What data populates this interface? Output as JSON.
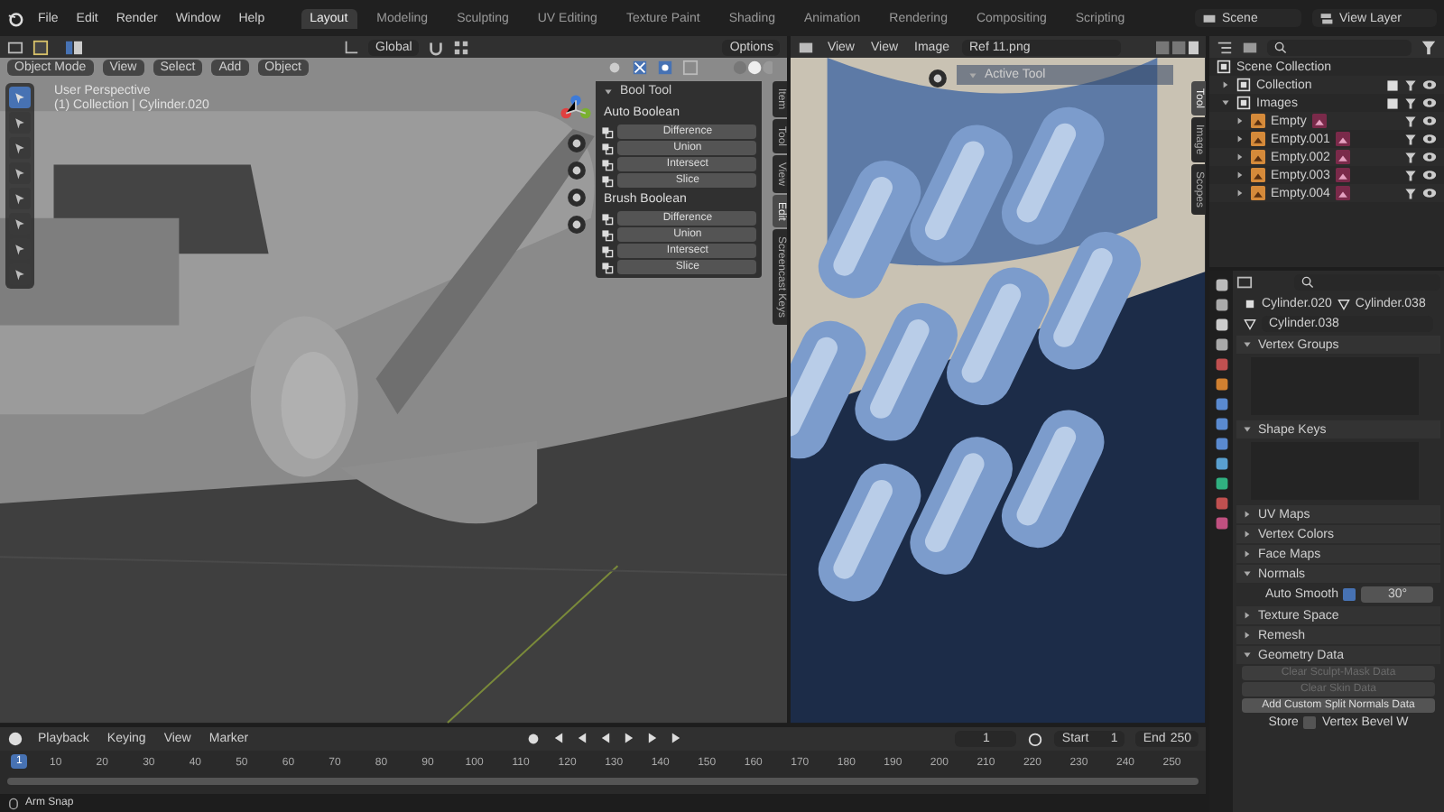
{
  "top_bar": {
    "menus": [
      "File",
      "Edit",
      "Render",
      "Window",
      "Help"
    ],
    "workspaces": [
      {
        "label": "Layout",
        "selected": true
      },
      {
        "label": "Modeling",
        "selected": false
      },
      {
        "label": "Sculpting",
        "selected": false
      },
      {
        "label": "UV Editing",
        "selected": false
      },
      {
        "label": "Texture Paint",
        "selected": false
      },
      {
        "label": "Shading",
        "selected": false
      },
      {
        "label": "Animation",
        "selected": false
      },
      {
        "label": "Rendering",
        "selected": false
      },
      {
        "label": "Compositing",
        "selected": false
      },
      {
        "label": "Scripting",
        "selected": false
      }
    ],
    "scene": "Scene",
    "view_layer": "View Layer"
  },
  "viewport": {
    "orientation": "Global",
    "options": "Options",
    "mode": "Object Mode",
    "menus": [
      "View",
      "Select",
      "Add",
      "Object"
    ],
    "overlay_text": [
      "User Perspective",
      "(1) Collection | Cylinder.020"
    ],
    "bool_tool": {
      "title": "Bool Tool",
      "sections": [
        {
          "heading": "Auto Boolean",
          "buttons": [
            "Difference",
            "Union",
            "Intersect",
            "Slice"
          ]
        },
        {
          "heading": "Brush Boolean",
          "buttons": [
            "Difference",
            "Union",
            "Intersect",
            "Slice"
          ]
        }
      ]
    },
    "side_tabs": [
      {
        "label": "Item",
        "selected": false
      },
      {
        "label": "Tool",
        "selected": false
      },
      {
        "label": "View",
        "selected": false
      },
      {
        "label": "Edit",
        "selected": true
      },
      {
        "label": "Screencast Keys",
        "selected": false
      }
    ]
  },
  "image_editor": {
    "menus": [
      "View",
      "View",
      "Image"
    ],
    "image_name": "Ref 11.png",
    "panel_title": "Active Tool",
    "side_tabs": [
      {
        "label": "Tool",
        "selected": true
      },
      {
        "label": "Image",
        "selected": false
      },
      {
        "label": "Scopes",
        "selected": false
      }
    ]
  },
  "outliner": {
    "root": "Scene Collection",
    "items": [
      {
        "label": "Collection",
        "expanded": false,
        "kind": "collection"
      },
      {
        "label": "Images",
        "expanded": true,
        "kind": "collection",
        "children": [
          {
            "label": "Empty",
            "expanded": false,
            "kind": "empty"
          },
          {
            "label": "Empty.001",
            "expanded": false,
            "kind": "empty"
          },
          {
            "label": "Empty.002",
            "expanded": false,
            "kind": "empty"
          },
          {
            "label": "Empty.003",
            "expanded": false,
            "kind": "empty"
          },
          {
            "label": "Empty.004",
            "expanded": false,
            "kind": "empty"
          }
        ]
      }
    ]
  },
  "properties": {
    "breadcrumb": [
      "Cylinder.020",
      "Cylinder.038"
    ],
    "mesh_name": "Cylinder.038",
    "panels": [
      {
        "title": "Vertex Groups",
        "expanded": true,
        "kind": "list"
      },
      {
        "title": "Shape Keys",
        "expanded": true,
        "kind": "list"
      },
      {
        "title": "UV Maps",
        "expanded": false
      },
      {
        "title": "Vertex Colors",
        "expanded": false
      },
      {
        "title": "Face Maps",
        "expanded": false
      },
      {
        "title": "Normals",
        "expanded": true,
        "kind": "normals",
        "label": "Auto Smooth",
        "checked": true,
        "angle": "30°"
      },
      {
        "title": "Texture Space",
        "expanded": false
      },
      {
        "title": "Remesh",
        "expanded": false
      },
      {
        "title": "Geometry Data",
        "expanded": true,
        "kind": "geometry",
        "buttons": [
          {
            "label": "Clear Sculpt-Mask Data",
            "disabled": true
          },
          {
            "label": "Clear Skin Data",
            "disabled": true
          },
          {
            "label": "Add Custom Split Normals Data",
            "disabled": false
          }
        ],
        "store_label": "Store",
        "store_option": "Vertex Bevel W",
        "store_checked": false
      }
    ]
  },
  "timeline": {
    "menus": [
      "Playback",
      "Keying",
      "View",
      "Marker"
    ],
    "current_frame": "1",
    "start_label": "Start",
    "start": "1",
    "end_label": "End",
    "end": "250",
    "playhead": "1",
    "ticks": [
      "10",
      "20",
      "30",
      "40",
      "50",
      "60",
      "70",
      "80",
      "90",
      "100",
      "110",
      "120",
      "130",
      "140",
      "150",
      "160",
      "170",
      "180",
      "190",
      "200",
      "210",
      "220",
      "230",
      "240",
      "250"
    ]
  },
  "status_bar": {
    "text": "Arm Snap"
  }
}
